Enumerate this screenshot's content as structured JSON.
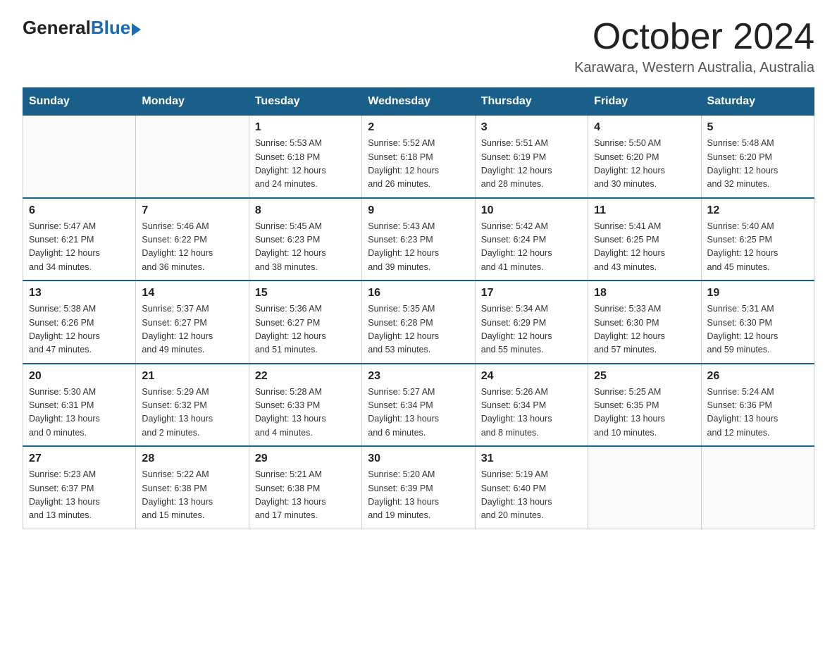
{
  "header": {
    "logo_general": "General",
    "logo_blue": "Blue",
    "title": "October 2024",
    "subtitle": "Karawara, Western Australia, Australia"
  },
  "days_of_week": [
    "Sunday",
    "Monday",
    "Tuesday",
    "Wednesday",
    "Thursday",
    "Friday",
    "Saturday"
  ],
  "weeks": [
    [
      {
        "day": "",
        "info": ""
      },
      {
        "day": "",
        "info": ""
      },
      {
        "day": "1",
        "info": "Sunrise: 5:53 AM\nSunset: 6:18 PM\nDaylight: 12 hours\nand 24 minutes."
      },
      {
        "day": "2",
        "info": "Sunrise: 5:52 AM\nSunset: 6:18 PM\nDaylight: 12 hours\nand 26 minutes."
      },
      {
        "day": "3",
        "info": "Sunrise: 5:51 AM\nSunset: 6:19 PM\nDaylight: 12 hours\nand 28 minutes."
      },
      {
        "day": "4",
        "info": "Sunrise: 5:50 AM\nSunset: 6:20 PM\nDaylight: 12 hours\nand 30 minutes."
      },
      {
        "day": "5",
        "info": "Sunrise: 5:48 AM\nSunset: 6:20 PM\nDaylight: 12 hours\nand 32 minutes."
      }
    ],
    [
      {
        "day": "6",
        "info": "Sunrise: 5:47 AM\nSunset: 6:21 PM\nDaylight: 12 hours\nand 34 minutes."
      },
      {
        "day": "7",
        "info": "Sunrise: 5:46 AM\nSunset: 6:22 PM\nDaylight: 12 hours\nand 36 minutes."
      },
      {
        "day": "8",
        "info": "Sunrise: 5:45 AM\nSunset: 6:23 PM\nDaylight: 12 hours\nand 38 minutes."
      },
      {
        "day": "9",
        "info": "Sunrise: 5:43 AM\nSunset: 6:23 PM\nDaylight: 12 hours\nand 39 minutes."
      },
      {
        "day": "10",
        "info": "Sunrise: 5:42 AM\nSunset: 6:24 PM\nDaylight: 12 hours\nand 41 minutes."
      },
      {
        "day": "11",
        "info": "Sunrise: 5:41 AM\nSunset: 6:25 PM\nDaylight: 12 hours\nand 43 minutes."
      },
      {
        "day": "12",
        "info": "Sunrise: 5:40 AM\nSunset: 6:25 PM\nDaylight: 12 hours\nand 45 minutes."
      }
    ],
    [
      {
        "day": "13",
        "info": "Sunrise: 5:38 AM\nSunset: 6:26 PM\nDaylight: 12 hours\nand 47 minutes."
      },
      {
        "day": "14",
        "info": "Sunrise: 5:37 AM\nSunset: 6:27 PM\nDaylight: 12 hours\nand 49 minutes."
      },
      {
        "day": "15",
        "info": "Sunrise: 5:36 AM\nSunset: 6:27 PM\nDaylight: 12 hours\nand 51 minutes."
      },
      {
        "day": "16",
        "info": "Sunrise: 5:35 AM\nSunset: 6:28 PM\nDaylight: 12 hours\nand 53 minutes."
      },
      {
        "day": "17",
        "info": "Sunrise: 5:34 AM\nSunset: 6:29 PM\nDaylight: 12 hours\nand 55 minutes."
      },
      {
        "day": "18",
        "info": "Sunrise: 5:33 AM\nSunset: 6:30 PM\nDaylight: 12 hours\nand 57 minutes."
      },
      {
        "day": "19",
        "info": "Sunrise: 5:31 AM\nSunset: 6:30 PM\nDaylight: 12 hours\nand 59 minutes."
      }
    ],
    [
      {
        "day": "20",
        "info": "Sunrise: 5:30 AM\nSunset: 6:31 PM\nDaylight: 13 hours\nand 0 minutes."
      },
      {
        "day": "21",
        "info": "Sunrise: 5:29 AM\nSunset: 6:32 PM\nDaylight: 13 hours\nand 2 minutes."
      },
      {
        "day": "22",
        "info": "Sunrise: 5:28 AM\nSunset: 6:33 PM\nDaylight: 13 hours\nand 4 minutes."
      },
      {
        "day": "23",
        "info": "Sunrise: 5:27 AM\nSunset: 6:34 PM\nDaylight: 13 hours\nand 6 minutes."
      },
      {
        "day": "24",
        "info": "Sunrise: 5:26 AM\nSunset: 6:34 PM\nDaylight: 13 hours\nand 8 minutes."
      },
      {
        "day": "25",
        "info": "Sunrise: 5:25 AM\nSunset: 6:35 PM\nDaylight: 13 hours\nand 10 minutes."
      },
      {
        "day": "26",
        "info": "Sunrise: 5:24 AM\nSunset: 6:36 PM\nDaylight: 13 hours\nand 12 minutes."
      }
    ],
    [
      {
        "day": "27",
        "info": "Sunrise: 5:23 AM\nSunset: 6:37 PM\nDaylight: 13 hours\nand 13 minutes."
      },
      {
        "day": "28",
        "info": "Sunrise: 5:22 AM\nSunset: 6:38 PM\nDaylight: 13 hours\nand 15 minutes."
      },
      {
        "day": "29",
        "info": "Sunrise: 5:21 AM\nSunset: 6:38 PM\nDaylight: 13 hours\nand 17 minutes."
      },
      {
        "day": "30",
        "info": "Sunrise: 5:20 AM\nSunset: 6:39 PM\nDaylight: 13 hours\nand 19 minutes."
      },
      {
        "day": "31",
        "info": "Sunrise: 5:19 AM\nSunset: 6:40 PM\nDaylight: 13 hours\nand 20 minutes."
      },
      {
        "day": "",
        "info": ""
      },
      {
        "day": "",
        "info": ""
      }
    ]
  ]
}
